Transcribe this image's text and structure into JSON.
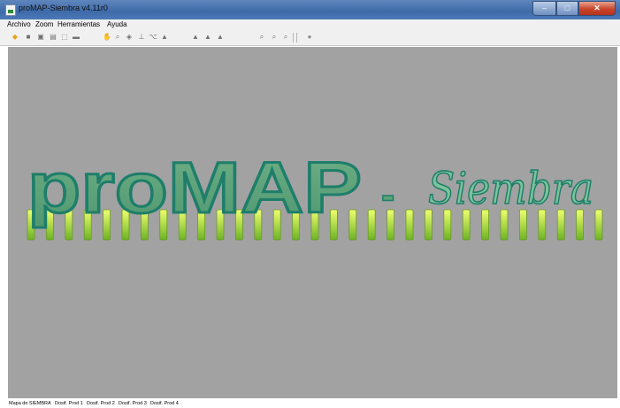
{
  "window": {
    "title": "proMAP-Siembra v4.11r0",
    "minimize": "–",
    "maximize": "□",
    "close": "✕"
  },
  "menu": [
    "Archivo",
    "Zoom",
    "Herramientas",
    "Ayuda"
  ],
  "toolbar_icons": [
    "new-file-icon",
    "save-icon",
    "save-as-icon",
    "print-preview-icon",
    "export-icon",
    "print-icon",
    "pan-icon",
    "zoom-area-icon",
    "layer-icon",
    "ruler-icon",
    "route-icon",
    "point-icon",
    "move-up-icon",
    "move-left-icon",
    "move-right-icon",
    "zoom-in-icon",
    "zoom-out-icon",
    "zoom-extent-icon",
    "record-icon"
  ],
  "logo": {
    "main": "proMAP",
    "dash": "-",
    "script": "Siembra",
    "colors": {
      "fill": "#5aa377",
      "stroke": "#1e7e6a",
      "bar_top": "#f0ff70",
      "bar_bottom": "#6db325"
    }
  },
  "tabs": [
    "Mapa de SIEMBRA",
    "Dosif. Prod 1",
    "Dosif. Prod 2",
    "Dosif. Prod 3",
    "Dosif. Prod 4"
  ]
}
